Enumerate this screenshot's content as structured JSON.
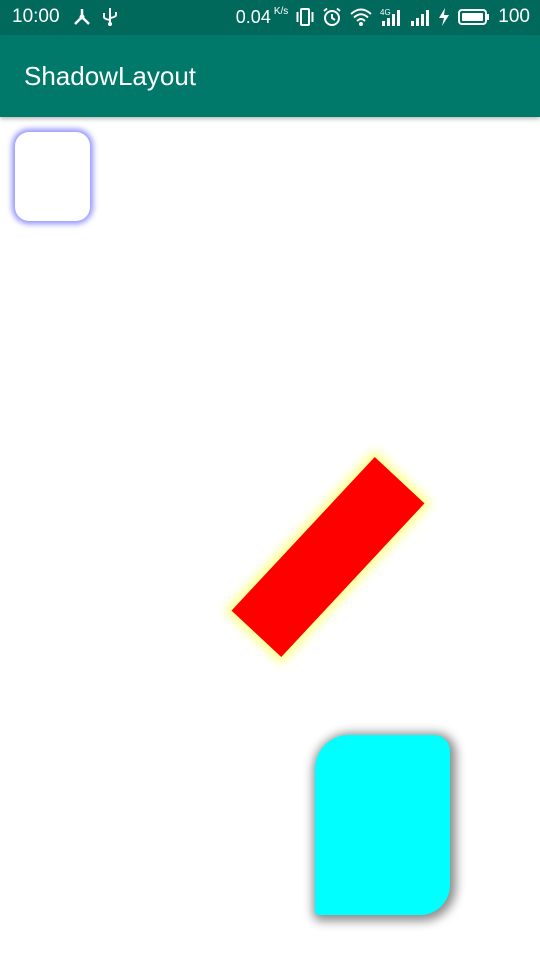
{
  "status_bar": {
    "time": "10:00",
    "net_speed": "0.04",
    "net_speed_unit": "K/s",
    "battery_level": "100",
    "left_icons": [
      "share-icon",
      "usb-icon"
    ],
    "right_icons": [
      "vibrate-icon",
      "alarm-icon",
      "wifi-icon",
      "signal-4g-icon",
      "signal-icon",
      "charging-icon",
      "battery-icon"
    ]
  },
  "app_bar": {
    "title": "ShadowLayout"
  },
  "shapes": {
    "blue_card": {
      "fill": "#ffffff",
      "shadow_color": "#7070ff"
    },
    "red_rect": {
      "fill": "#ff0000",
      "shadow_color": "#ffff80"
    },
    "cyan_card": {
      "fill": "#00ffff",
      "shadow_color": "#555555"
    }
  },
  "colors": {
    "status_bar": "#00695c",
    "app_bar": "#00796b"
  }
}
